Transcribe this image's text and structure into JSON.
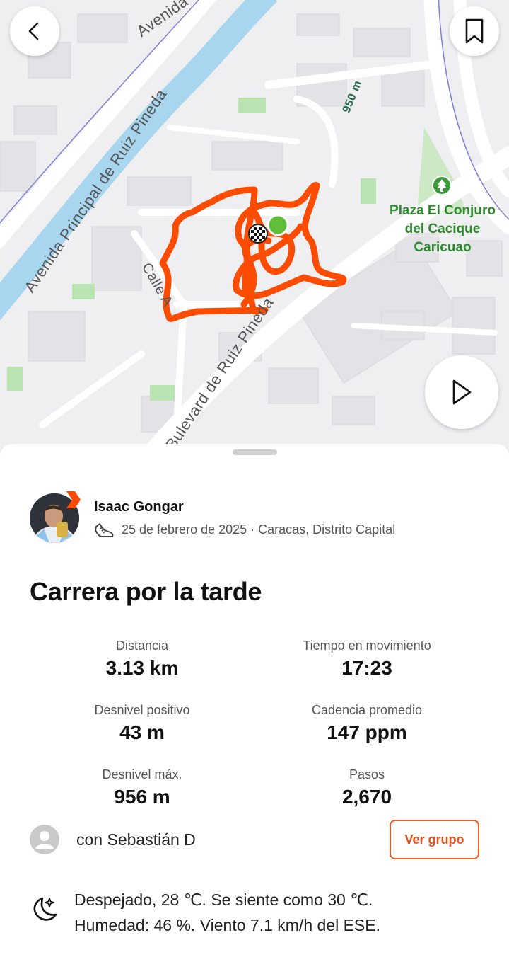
{
  "map": {
    "street_labels": [
      "Avenida Principal de Ruiz Pineda",
      "Bulevard de Ruiz Pineda",
      "Calle A",
      "Avenida",
      "950 m"
    ],
    "poi": {
      "name_lines": [
        "Plaza El Conjuro",
        "del Cacique",
        "Caricuao"
      ],
      "icon": "tree-icon"
    },
    "route_color": "#fc4c02",
    "start_marker_color": "#5fbf3a",
    "end_marker": "checkered-flag-icon"
  },
  "controls": {
    "back_icon": "chevron-left-icon",
    "bookmark_icon": "bookmark-icon",
    "play_icon": "play-icon"
  },
  "athlete": {
    "name": "Isaac Gongar",
    "date_location": "25 de febrero de 2025 · Caracas, Distrito Capital",
    "activity_icon": "running-shoe-icon"
  },
  "activity": {
    "title": "Carrera por la tarde"
  },
  "stats": [
    {
      "label": "Distancia",
      "value": "3.13 km"
    },
    {
      "label": "Tiempo en movimiento",
      "value": "17:23"
    },
    {
      "label": "Desnivel positivo",
      "value": "43 m"
    },
    {
      "label": "Cadencia promedio",
      "value": "147 ppm"
    },
    {
      "label": "Desnivel máx.",
      "value": "956 m"
    },
    {
      "label": "Pasos",
      "value": "2,670"
    }
  ],
  "group": {
    "with_text": "con Sebastián D",
    "button_label": "Ver grupo"
  },
  "weather": {
    "icon": "moon-stars-icon",
    "line1": "Despejado, 28 ℃. Se siente como 30 ℃.",
    "line2": "Humedad: 46 %. Viento 7.1 km/h del ESE."
  },
  "colors": {
    "accent": "#fc4c02",
    "poi_green": "#2c8a2c"
  }
}
